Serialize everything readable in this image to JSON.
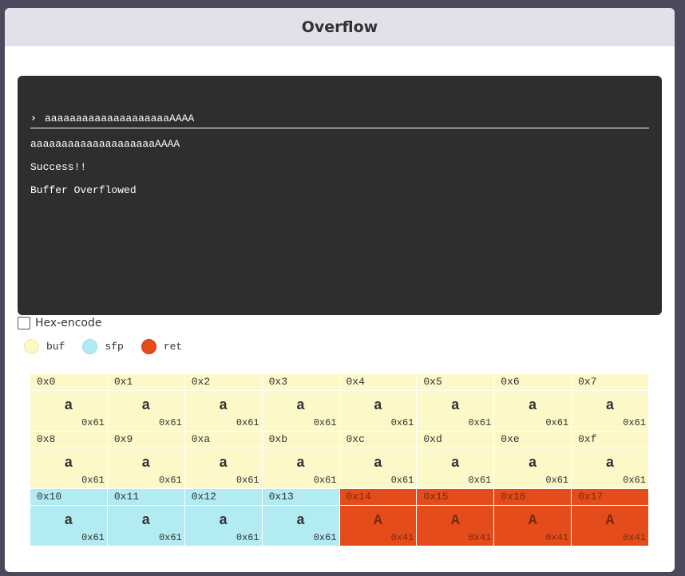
{
  "window": {
    "title": "Overflow"
  },
  "terminal": {
    "prompt_symbol": "›",
    "input_value": "aaaaaaaaaaaaaaaaaaaaAAAA",
    "output_lines": [
      "aaaaaaaaaaaaaaaaaaaaAAAA",
      "Success!!",
      "Buffer Overflowed"
    ]
  },
  "options": {
    "hex_encode_label": "Hex-encode",
    "hex_encode_checked": false
  },
  "legend": [
    {
      "label": "buf",
      "color": "#fdf8c8",
      "border": "#ece6b0"
    },
    {
      "label": "sfp",
      "color": "#b3ebf2",
      "border": "#9ad9e4"
    },
    {
      "label": "ret",
      "color": "#e44c1c",
      "border": "#c73d10"
    }
  ],
  "memory": [
    {
      "addr": "0x0",
      "char": "a",
      "hex": "0x61",
      "region": "buf"
    },
    {
      "addr": "0x1",
      "char": "a",
      "hex": "0x61",
      "region": "buf"
    },
    {
      "addr": "0x2",
      "char": "a",
      "hex": "0x61",
      "region": "buf"
    },
    {
      "addr": "0x3",
      "char": "a",
      "hex": "0x61",
      "region": "buf"
    },
    {
      "addr": "0x4",
      "char": "a",
      "hex": "0x61",
      "region": "buf"
    },
    {
      "addr": "0x5",
      "char": "a",
      "hex": "0x61",
      "region": "buf"
    },
    {
      "addr": "0x6",
      "char": "a",
      "hex": "0x61",
      "region": "buf"
    },
    {
      "addr": "0x7",
      "char": "a",
      "hex": "0x61",
      "region": "buf"
    },
    {
      "addr": "0x8",
      "char": "a",
      "hex": "0x61",
      "region": "buf"
    },
    {
      "addr": "0x9",
      "char": "a",
      "hex": "0x61",
      "region": "buf"
    },
    {
      "addr": "0xa",
      "char": "a",
      "hex": "0x61",
      "region": "buf"
    },
    {
      "addr": "0xb",
      "char": "a",
      "hex": "0x61",
      "region": "buf"
    },
    {
      "addr": "0xc",
      "char": "a",
      "hex": "0x61",
      "region": "buf"
    },
    {
      "addr": "0xd",
      "char": "a",
      "hex": "0x61",
      "region": "buf"
    },
    {
      "addr": "0xe",
      "char": "a",
      "hex": "0x61",
      "region": "buf"
    },
    {
      "addr": "0xf",
      "char": "a",
      "hex": "0x61",
      "region": "buf"
    },
    {
      "addr": "0x10",
      "char": "a",
      "hex": "0x61",
      "region": "sfp"
    },
    {
      "addr": "0x11",
      "char": "a",
      "hex": "0x61",
      "region": "sfp"
    },
    {
      "addr": "0x12",
      "char": "a",
      "hex": "0x61",
      "region": "sfp"
    },
    {
      "addr": "0x13",
      "char": "a",
      "hex": "0x61",
      "region": "sfp"
    },
    {
      "addr": "0x14",
      "char": "A",
      "hex": "0x41",
      "region": "ret"
    },
    {
      "addr": "0x15",
      "char": "A",
      "hex": "0x41",
      "region": "ret"
    },
    {
      "addr": "0x16",
      "char": "A",
      "hex": "0x41",
      "region": "ret"
    },
    {
      "addr": "0x17",
      "char": "A",
      "hex": "0x41",
      "region": "ret"
    }
  ]
}
